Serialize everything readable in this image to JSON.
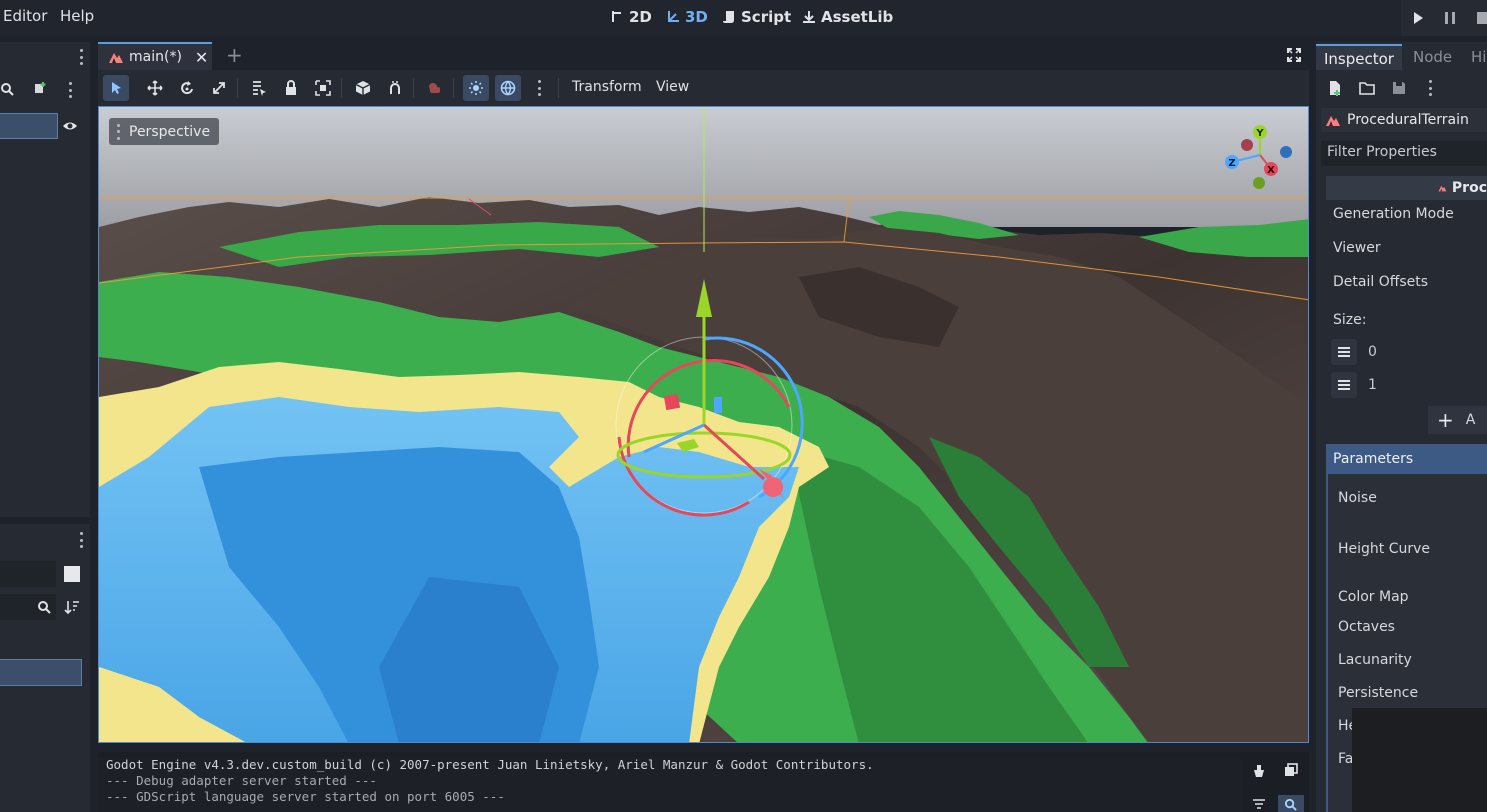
{
  "menu": {
    "editor": "Editor",
    "help": "Help"
  },
  "workspaces": [
    {
      "label": "2D",
      "icon": "2d-icon",
      "active": false
    },
    {
      "label": "3D",
      "icon": "3d-icon",
      "active": true
    },
    {
      "label": "Script",
      "icon": "script-icon",
      "active": false
    },
    {
      "label": "AssetLib",
      "icon": "assetlib-icon",
      "active": false
    }
  ],
  "scene_tab": {
    "label": "main(*)"
  },
  "toolbar": {
    "transform_menu": "Transform",
    "view_menu": "View"
  },
  "viewport": {
    "perspective_label": "Perspective",
    "gizmo_axes": {
      "x": "X",
      "y": "Y",
      "z": "Z"
    }
  },
  "output": {
    "lines": [
      "Godot Engine v4.3.dev.custom_build (c) 2007-present Juan Linietsky, Ariel Manzur & Godot Contributors.",
      "--- Debug adapter server started ---",
      "--- GDScript language server started on port 6005 ---"
    ]
  },
  "inspector": {
    "tabs": {
      "inspector": "Inspector",
      "node": "Node",
      "history": "His"
    },
    "node_name": "ProceduralTerrain",
    "filter_placeholder": "Filter Properties",
    "class_header": "Proc",
    "properties": {
      "generation_mode": "Generation Mode",
      "viewer": "Viewer",
      "detail_offsets": "Detail Offsets",
      "size": "Size:",
      "size_items": [
        "0",
        "1"
      ],
      "add_label": "A"
    },
    "parameters": {
      "title": "Parameters",
      "noise": "Noise",
      "height_curve": "Height Curve",
      "color_map": "Color Map",
      "octaves": "Octaves",
      "lacunarity": "Lacunarity",
      "persistence": "Persistence",
      "he": "He",
      "fa": "Fa"
    }
  },
  "colors": {
    "accent": "#5e9cdc",
    "water_light": "#6cbcf0",
    "water_deep": "#2f86d8",
    "sand": "#f2e58c",
    "grass": "#3aa84a",
    "mountain": "#4a3f3c"
  }
}
